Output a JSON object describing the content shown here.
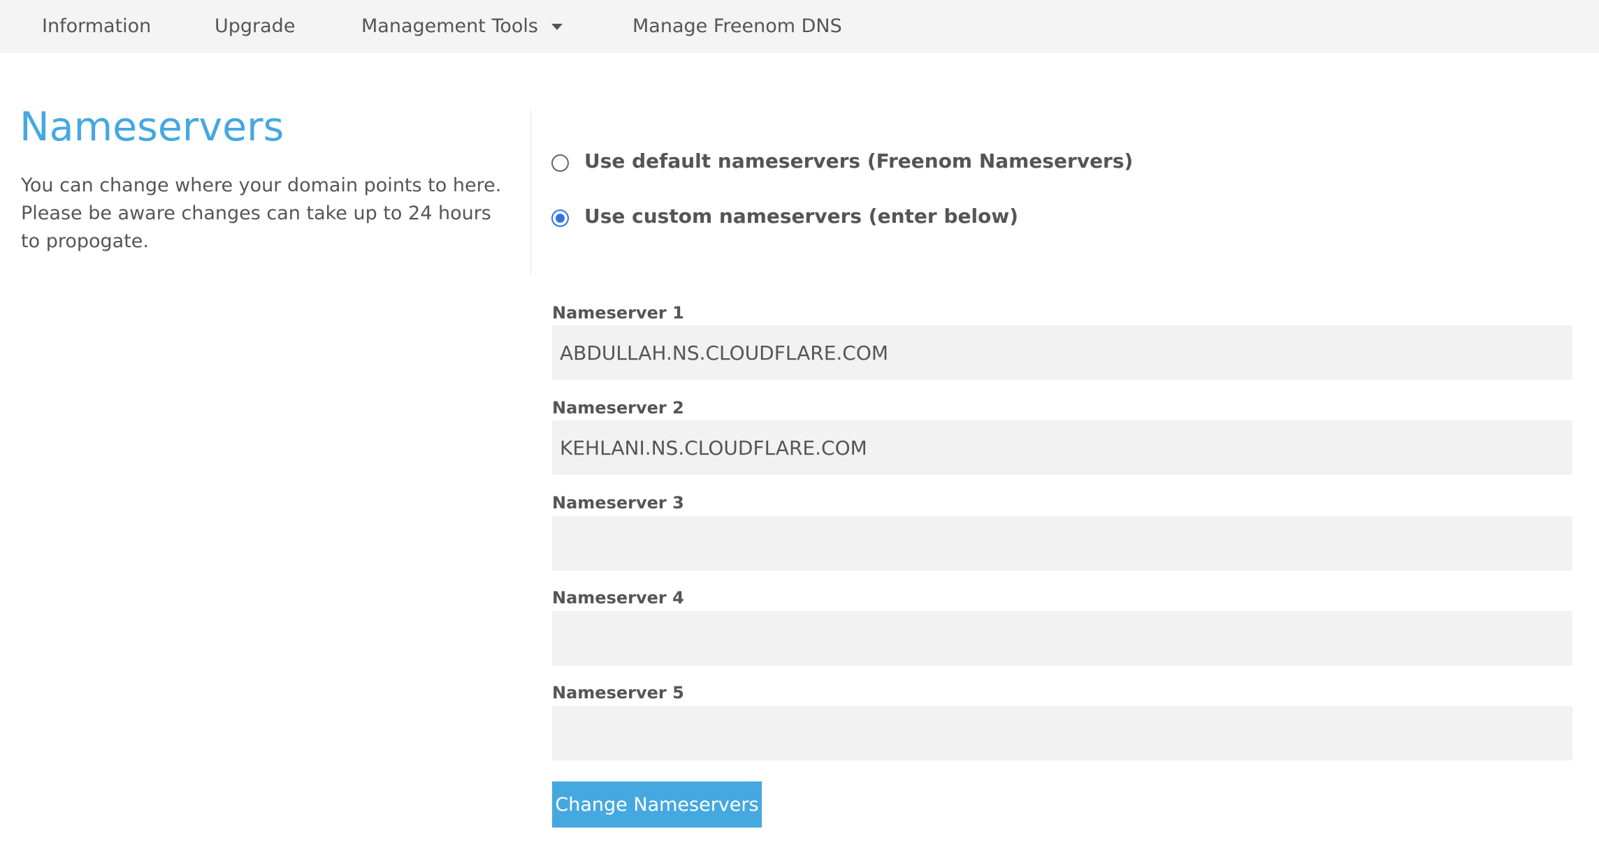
{
  "nav": {
    "items": [
      {
        "label": "Information"
      },
      {
        "label": "Upgrade"
      },
      {
        "label": "Management Tools"
      },
      {
        "label": "Manage Freenom DNS"
      }
    ]
  },
  "icons": {
    "management_tools_caret": "chevron-down-icon"
  },
  "colors": {
    "accent": "#45a8e0",
    "radio_selected": "#2f74e6",
    "nav_background": "#f4f4f4",
    "input_background": "#f2f2f2"
  },
  "page": {
    "title": "Nameservers",
    "description": "You can change where your domain points to here. Please be aware changes can take up to 24 hours to propogate."
  },
  "options": {
    "default_label": "Use default nameservers (Freenom Nameservers)",
    "default_selected": false,
    "custom_label": "Use custom nameservers (enter below)",
    "custom_selected": true
  },
  "nameservers": [
    {
      "label": "Nameserver 1",
      "value": "ABDULLAH.NS.CLOUDFLARE.COM"
    },
    {
      "label": "Nameserver 2",
      "value": "KEHLANI.NS.CLOUDFLARE.COM"
    },
    {
      "label": "Nameserver 3",
      "value": ""
    },
    {
      "label": "Nameserver 4",
      "value": ""
    },
    {
      "label": "Nameserver 5",
      "value": ""
    }
  ],
  "submit": {
    "label": "Change Nameservers"
  }
}
